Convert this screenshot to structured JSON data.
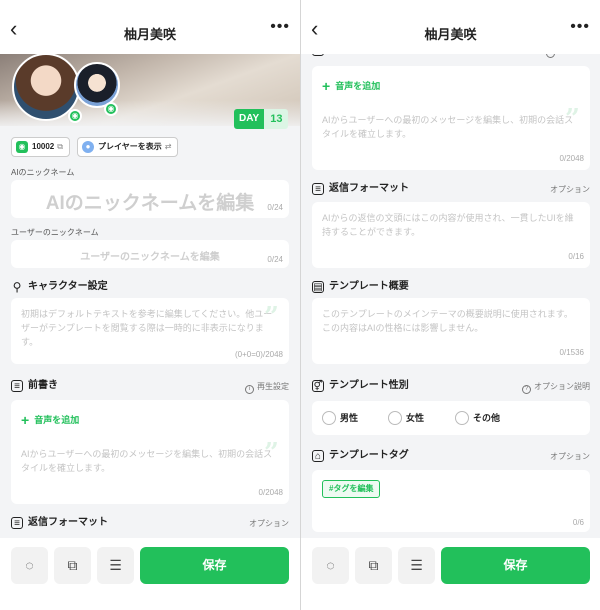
{
  "nav": {
    "title": "柚月美咲",
    "back_icon": "back-arrow-icon",
    "more_icon": "more-icon"
  },
  "profile": {
    "day_label": "DAY",
    "day_count": "13",
    "id_value": "10002",
    "player_label": "プレイヤーを表示"
  },
  "ai_nickname": {
    "label": "AIのニックネーム",
    "placeholder": "AIのニックネームを編集",
    "count": "0/24"
  },
  "user_nickname": {
    "label": "ユーザーのニックネーム",
    "placeholder": "ユーザーのニックネームを編集",
    "count": "0/24"
  },
  "character": {
    "title": "キャラクター設定",
    "placeholder": "初期はデフォルトテキストを参考に編集してください。他ユーザーがテンプレートを閲覧する際は一時的に非表示になります。",
    "count": "(0+0=0)/2048"
  },
  "preface": {
    "title": "前書き",
    "title_cut": "前書き",
    "right": "再生設定",
    "voice_add": "音声を追加",
    "placeholder": "AIからユーザーへの最初のメッセージを編集し、初期の会話スタイルを確立します。",
    "count": "0/2048"
  },
  "reply_format": {
    "title": "返信フォーマット",
    "right": "オプション",
    "placeholder": "AIからの返信の文頭にはこの内容が使用され、一貫したUIを維持することができます。",
    "count": "0/16"
  },
  "template_summary": {
    "title": "テンプレート概要",
    "placeholder": "このテンプレートのメインテーマの概要説明に使用されます。この内容はAIの性格には影響しません。",
    "count": "0/1536"
  },
  "template_gender": {
    "title": "テンプレート性別",
    "right": "オプション説明",
    "options": [
      "男性",
      "女性",
      "その他"
    ]
  },
  "template_tag": {
    "title": "テンプレートタグ",
    "right": "オプション",
    "button": "#タグを編集",
    "count": "0/6"
  },
  "footer": {
    "save": "保存"
  },
  "colors": {
    "accent": "#22c05b",
    "background": "#f3f4f6"
  }
}
